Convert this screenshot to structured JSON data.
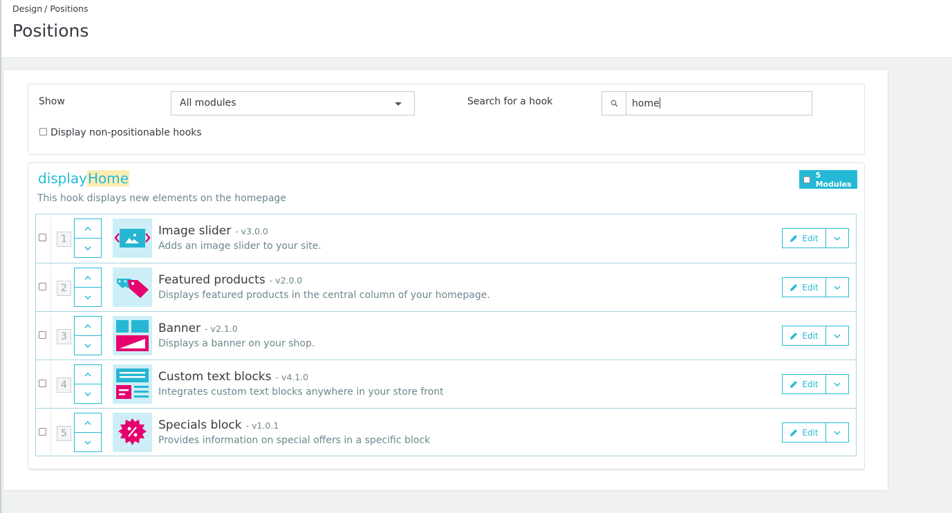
{
  "breadcrumb": {
    "parent": "Design",
    "separator": "/",
    "current": "Positions"
  },
  "page": {
    "title": "Positions"
  },
  "filters": {
    "show_label": "Show",
    "show_value": "All modules",
    "search_label": "Search for a hook",
    "search_value": "home",
    "non_positionable_label": "Display non-positionable hooks"
  },
  "hook": {
    "name_prefix": "display",
    "name_highlight": "Home",
    "description": "This hook displays new elements on the homepage",
    "modules_badge": "5 Modules"
  },
  "modules": [
    {
      "position": "1",
      "name": "Image slider",
      "version": "- v3.0.0",
      "description": "Adds an image slider to your site.",
      "icon": "image-slider-icon",
      "edit_label": "Edit"
    },
    {
      "position": "2",
      "name": "Featured products",
      "version": "- v2.0.0",
      "description": "Displays featured products in the central column of your homepage.",
      "icon": "featured-products-icon",
      "edit_label": "Edit"
    },
    {
      "position": "3",
      "name": "Banner",
      "version": "- v2.1.0",
      "description": "Displays a banner on your shop.",
      "icon": "banner-icon",
      "edit_label": "Edit"
    },
    {
      "position": "4",
      "name": "Custom text blocks",
      "version": "- v4.1.0",
      "description": "Integrates custom text blocks anywhere in your store front",
      "icon": "custom-text-blocks-icon",
      "edit_label": "Edit"
    },
    {
      "position": "5",
      "name": "Specials block",
      "version": "- v1.0.1",
      "description": "Provides information on special offers in a specific block",
      "icon": "specials-block-icon",
      "edit_label": "Edit"
    }
  ],
  "colors": {
    "accent": "#25b9d7",
    "pink": "#e6006e",
    "icon_bg": "#cdeef6"
  }
}
